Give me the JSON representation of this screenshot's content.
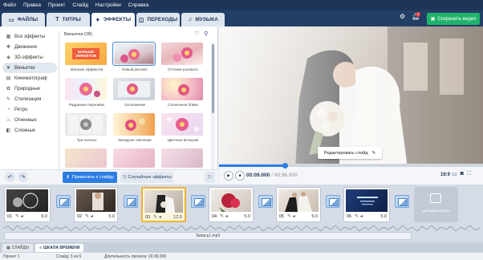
{
  "menu": [
    "Файл",
    "Правка",
    "Проект",
    "Слайд",
    "Настройки",
    "Справка"
  ],
  "tabs": [
    {
      "label": "ФАЙЛЫ",
      "icon": "folder-icon"
    },
    {
      "label": "ТИТРЫ",
      "icon": "text-icon"
    },
    {
      "label": "ЭФФЕКТЫ",
      "icon": "effects-star-icon"
    },
    {
      "label": "ПЕРЕХОДЫ",
      "icon": "transition-icon"
    },
    {
      "label": "МУЗЫКА",
      "icon": "music-note-icon"
    }
  ],
  "active_tab": "ЭФФЕКТЫ",
  "notifications_count": "2",
  "save_label": "Сохранить видео",
  "categories": [
    {
      "label": "Все эффекты",
      "icon": "grid-icon"
    },
    {
      "label": "Движения",
      "icon": "move-icon"
    },
    {
      "label": "3D-эффекты",
      "icon": "cube-icon"
    },
    {
      "label": "Виньетки",
      "icon": "leaf-icon"
    },
    {
      "label": "Кинематограф",
      "icon": "film-icon"
    },
    {
      "label": "Природные",
      "icon": "nature-icon"
    },
    {
      "label": "Стилизация",
      "icon": "brush-icon"
    },
    {
      "label": "Ретро",
      "icon": "retro-icon"
    },
    {
      "label": "Огненные",
      "icon": "fire-icon"
    },
    {
      "label": "Сложные",
      "icon": "layers-icon"
    }
  ],
  "active_category": "Виньетки",
  "grid_heading": "Виньетки (28)",
  "promo_text": "БОЛЬШЕ ЭФФЕКТОВ",
  "effects": [
    {
      "label": "Магазин эффектов"
    },
    {
      "label": "Новый рассвет"
    },
    {
      "label": "Оттенки розового"
    },
    {
      "label": "Радужные переливы"
    },
    {
      "label": "Скольжение"
    },
    {
      "label": "Солнечные блики"
    },
    {
      "label": "Три полосы"
    },
    {
      "label": "Западное свечение"
    },
    {
      "label": "Цветные вспышки"
    },
    {
      "label": ""
    },
    {
      "label": ""
    },
    {
      "label": ""
    }
  ],
  "selected_effect": "Новый рассвет",
  "apply_label": "Применить к слайду",
  "random_label": "Случайные эффекты",
  "edit_slide_label": "Редактировать слайд",
  "player": {
    "current": "00:09.000",
    "total": "/ 00:36.000",
    "ratio": "16:9",
    "progress": 0.25
  },
  "clips": [
    {
      "num": "01",
      "dur": "6.0"
    },
    {
      "num": "02",
      "dur": "5.0"
    },
    {
      "num": "03",
      "dur": "12.0"
    },
    {
      "num": "04",
      "dur": "5.0"
    },
    {
      "num": "05",
      "dur": "5.0"
    },
    {
      "num": "06",
      "dur": "5.0"
    }
  ],
  "selected_clip": "03",
  "add_photo_label": "Добавьте фото",
  "audio_label": "Запись1.mp3",
  "bottom_tabs": [
    {
      "label": "СЛАЙДЫ"
    },
    {
      "label": "ШКАЛА ВРЕМЕНИ"
    }
  ],
  "active_bottom_tab": "ШКАЛА ВРЕМЕНИ",
  "status": {
    "project": "Проект 1",
    "slide": "Слайд: 3 из 6",
    "duration": "Длительность проекта: 00:36.000"
  }
}
